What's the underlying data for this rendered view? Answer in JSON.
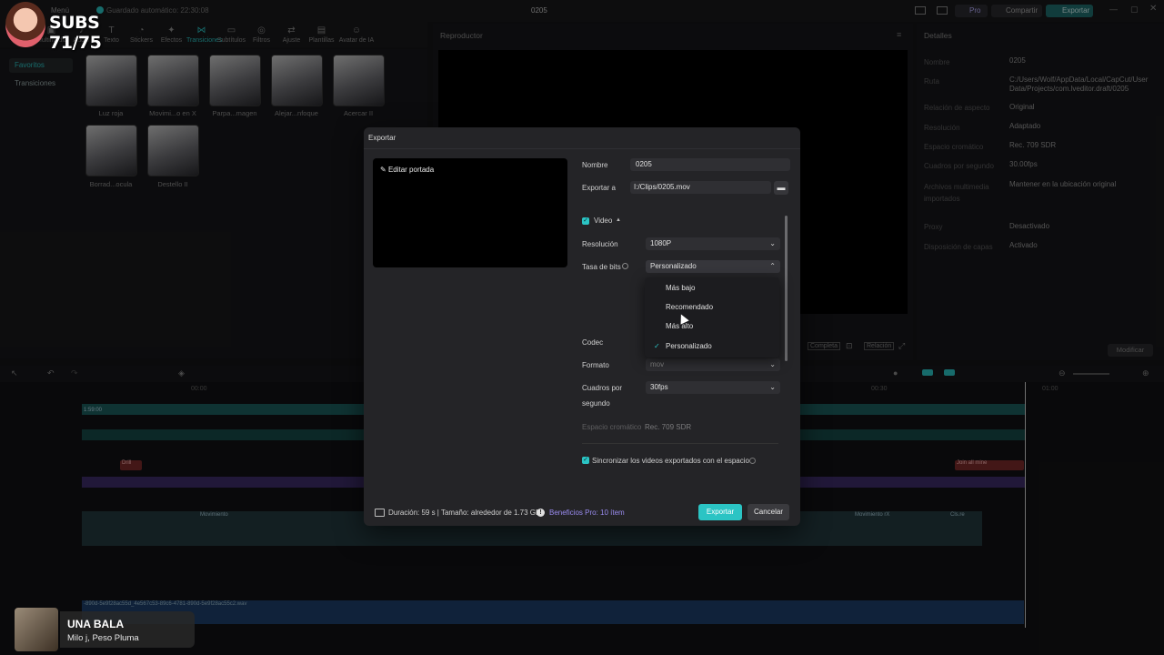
{
  "app": {
    "menu": "Menú",
    "autosave": "Guardado automático: 22:30:08",
    "project_name": "0205",
    "pro_label": "Pro",
    "share_label": "Compartir",
    "export_label": "Exportar",
    "toolbar": [
      "Multimedia",
      "Audio",
      "Texto",
      "Stickers",
      "Efectos",
      "Transiciones",
      "Subtítulos",
      "Filtros",
      "Ajuste",
      "Plantillas",
      "Avatar de IA"
    ],
    "sidebar": [
      "Favoritos",
      "Transiciones"
    ],
    "transitions": [
      "Luz roja",
      "Movimi...o en X",
      "Parpa...magen",
      "Alejar...nfoque",
      "Acercar II",
      "Borrad...ocula",
      "Destello II"
    ],
    "player_title": "Reproductor",
    "player_controls": [
      "Completa",
      "Relación"
    ],
    "details_title": "Detalles",
    "details": [
      {
        "k": "Nombre",
        "v": "0205"
      },
      {
        "k": "Ruta",
        "v": "C:/Users/Wolf/AppData/Local/CapCut/User Data/Projects/com.lveditor.draft/0205"
      },
      {
        "k": "Relación de aspecto",
        "v": "Original"
      },
      {
        "k": "Resolución",
        "v": "Adaptado"
      },
      {
        "k": "Espacio cromático",
        "v": "Rec. 709 SDR"
      },
      {
        "k": "Cuadros por segundo",
        "v": "30.00fps"
      },
      {
        "k": "Archivos multimedia importados",
        "v": "Mantener en la ubicación original"
      },
      {
        "k": "Proxy",
        "v": "Desactivado"
      },
      {
        "k": "Disposición de capas",
        "v": "Activado"
      }
    ],
    "modify_label": "Modificar",
    "timeline_times": [
      "00:00",
      "00:30",
      "01:00"
    ],
    "track_labels": [
      "1:59:00",
      "Drill",
      "Join all mine",
      "Movimiento",
      "Movimiento rX",
      "Cls.re"
    ],
    "audio_file": "-890d-5e9f28ac55d_4e567c53-89c6-4781-890d-5e9f28ac55c2.wav"
  },
  "overlay": {
    "subs": "SUBS 71/75",
    "song_title": "UNA BALA",
    "song_artist": "Milo j, Peso Pluma"
  },
  "dialog": {
    "title": "Exportar",
    "cover_edit": "Editar portada",
    "name_label": "Nombre",
    "name_value": "0205",
    "export_to_label": "Exportar a",
    "export_to_value": "I:/Clips/0205.mov",
    "video_label": "Video",
    "resolution_label": "Resolución",
    "resolution_value": "1080P",
    "bitrate_label": "Tasa de bits",
    "bitrate_value": "Personalizado",
    "bitrate_options": [
      "Más bajo",
      "Recomendado",
      "Más alto",
      "Personalizado"
    ],
    "codec_label": "Codec",
    "format_label": "Formato",
    "format_value": "mov",
    "fps_label_1": "Cuadros por",
    "fps_label_2": "segundo",
    "fps_value": "30fps",
    "colorspace_label": "Espacio cromático",
    "colorspace_value": "Rec. 709 SDR",
    "sync_label": "Sincronizar los videos exportados con el espacio",
    "duration": "Duración: 59 s | Tamaño: alrededor de 1.73 GB",
    "pro_benefits": "Beneficios Pro: 10 ítem",
    "export_button": "Exportar",
    "cancel_button": "Cancelar"
  },
  "colors": {
    "accent": "#2bc4c4",
    "pro": "#9a8cf0"
  }
}
